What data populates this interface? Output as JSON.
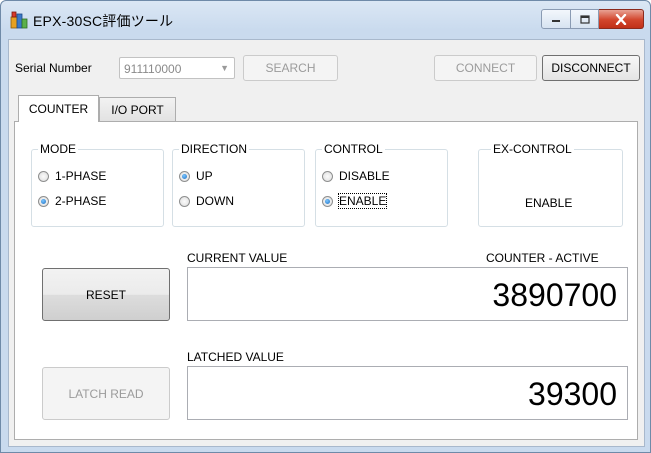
{
  "window": {
    "title": "EPX-30SC評価ツール"
  },
  "toolbar": {
    "serial_label": "Serial Number",
    "serial_value": "911110000",
    "search_label": "SEARCH",
    "connect_label": "CONNECT",
    "disconnect_label": "DISCONNECT"
  },
  "tabs": [
    {
      "label": "COUNTER",
      "active": true
    },
    {
      "label": "I/O PORT",
      "active": false
    }
  ],
  "mode": {
    "title": "MODE",
    "options": [
      "1-PHASE",
      "2-PHASE"
    ],
    "selected": "2-PHASE"
  },
  "direction": {
    "title": "DIRECTION",
    "options": [
      "UP",
      "DOWN"
    ],
    "selected": "UP"
  },
  "control": {
    "title": "CONTROL",
    "options": [
      "DISABLE",
      "ENABLE"
    ],
    "selected": "ENABLE"
  },
  "ex_control": {
    "title": "EX-CONTROL",
    "value": "ENABLE"
  },
  "current": {
    "label": "CURRENT VALUE",
    "status": "COUNTER - ACTIVE",
    "value": "3890700"
  },
  "latched": {
    "label": "LATCHED VALUE",
    "value": "39300"
  },
  "buttons": {
    "reset": "RESET",
    "latch_read": "LATCH READ"
  },
  "icons": {
    "app": "app-icon",
    "minimize": "minimize-icon",
    "maximize": "maximize-icon",
    "close": "close-icon",
    "dropdown": "chevron-down-icon"
  },
  "colors": {
    "close_button": "#d2452c",
    "radio_checked": "#1b6ec2",
    "titlebar": "#c9daee"
  }
}
